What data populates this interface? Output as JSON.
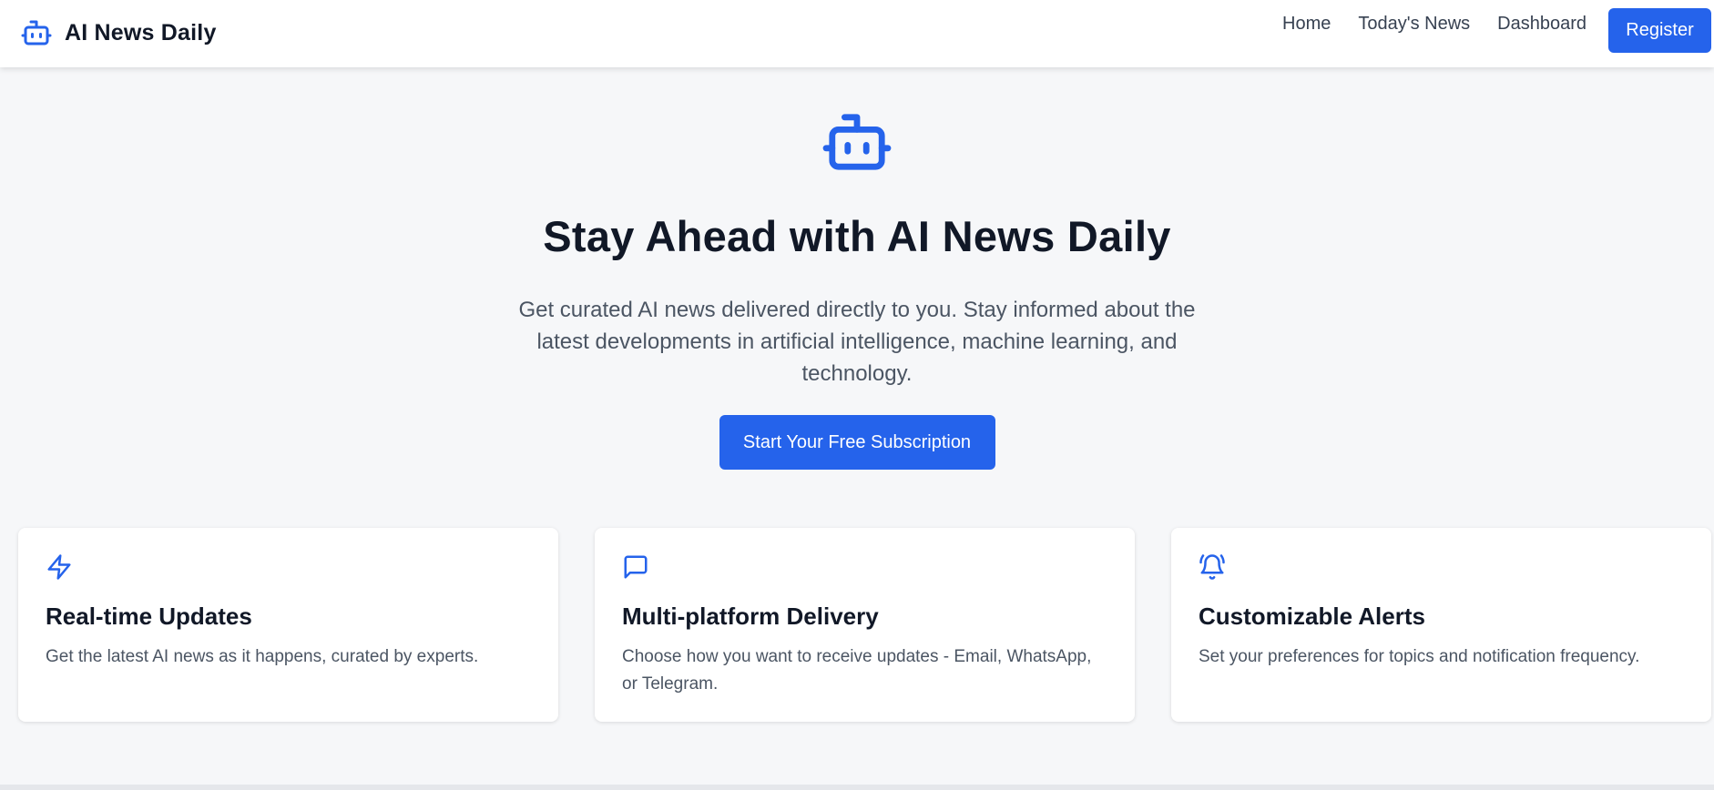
{
  "colors": {
    "accent": "#2563eb",
    "background": "#f6f7f9",
    "text": "#111827",
    "muted": "#4b5563"
  },
  "navbar": {
    "brand": "AI News Daily",
    "brand_icon": "robot-icon",
    "links": [
      "Home",
      "Today's News",
      "Dashboard"
    ],
    "register_label": "Register"
  },
  "hero": {
    "icon": "robot-icon",
    "title": "Stay Ahead with AI News Daily",
    "subtitle": "Get curated AI news delivered directly to you. Stay informed about the latest developments in artificial intelligence, machine learning, and technology.",
    "cta_label": "Start Your Free Subscription"
  },
  "features": [
    {
      "icon": "lightning-icon",
      "title": "Real-time Updates",
      "description": "Get the latest AI news as it happens, curated by experts."
    },
    {
      "icon": "chat-bubble-icon",
      "title": "Multi-platform Delivery",
      "description": "Choose how you want to receive updates - Email, WhatsApp, or Telegram."
    },
    {
      "icon": "bell-ringing-icon",
      "title": "Customizable Alerts",
      "description": "Set your preferences for topics and notification frequency."
    }
  ]
}
